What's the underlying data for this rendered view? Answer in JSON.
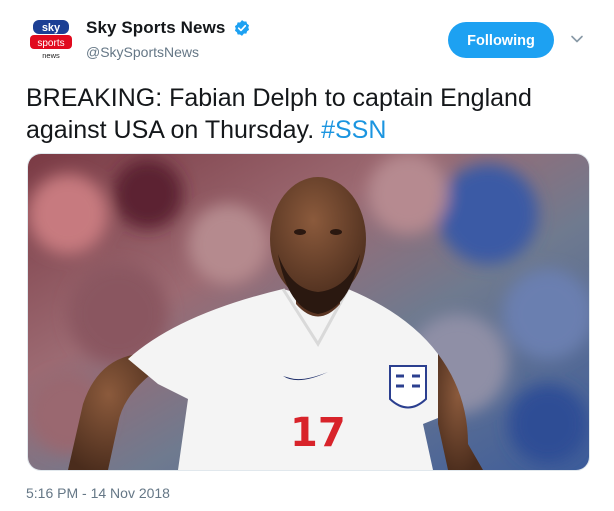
{
  "author": {
    "name": "Sky Sports News",
    "handle": "@SkySportsNews",
    "verified": true,
    "avatar_logo": {
      "line1": "sky",
      "line2": "sports",
      "line3": "news"
    }
  },
  "follow_button": {
    "label": "Following"
  },
  "tweet": {
    "text_line1": "BREAKING: Fabian Delph to captain England",
    "text_line2": "against USA on Thursday. ",
    "hashtag": "#SSN"
  },
  "media": {
    "shirt_number": "17"
  },
  "timestamp": "5:16 PM - 14 Nov 2018",
  "colors": {
    "accent": "#1da1f2",
    "link": "#1b95e0",
    "secondary_text": "#657786",
    "sky_red": "#e10a1e",
    "sky_blue": "#1c3f94"
  },
  "icons": [
    "verified-badge-icon",
    "chevron-down-icon"
  ]
}
